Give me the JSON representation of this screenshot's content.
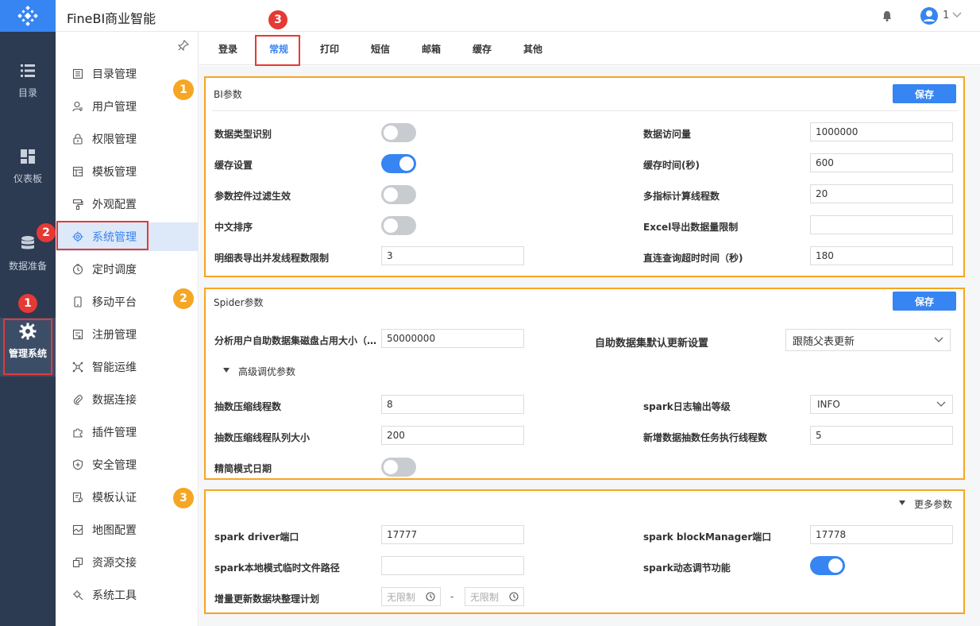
{
  "app_title": "FineBI商业智能",
  "user": {
    "name": "1"
  },
  "rail": [
    {
      "label": "目录",
      "icon": "list-icon"
    },
    {
      "label": "仪表板",
      "icon": "dashboard-icon"
    },
    {
      "label": "数据准备",
      "icon": "database-icon"
    },
    {
      "label": "管理系统",
      "icon": "gear-icon"
    }
  ],
  "menu": [
    {
      "label": "目录管理",
      "icon": "catalog-icon"
    },
    {
      "label": "用户管理",
      "icon": "user-icon"
    },
    {
      "label": "权限管理",
      "icon": "lock-icon"
    },
    {
      "label": "模板管理",
      "icon": "template-icon"
    },
    {
      "label": "外观配置",
      "icon": "brush-icon"
    },
    {
      "label": "系统管理",
      "icon": "settings-icon"
    },
    {
      "label": "定时调度",
      "icon": "clock-icon"
    },
    {
      "label": "移动平台",
      "icon": "mobile-icon"
    },
    {
      "label": "注册管理",
      "icon": "register-icon"
    },
    {
      "label": "智能运维",
      "icon": "nodes-icon"
    },
    {
      "label": "数据连接",
      "icon": "link-icon"
    },
    {
      "label": "插件管理",
      "icon": "plugin-icon"
    },
    {
      "label": "安全管理",
      "icon": "shield-icon"
    },
    {
      "label": "模板认证",
      "icon": "certificate-icon"
    },
    {
      "label": "地图配置",
      "icon": "map-icon"
    },
    {
      "label": "资源交接",
      "icon": "handover-icon"
    },
    {
      "label": "系统工具",
      "icon": "tool-icon"
    }
  ],
  "tabs": [
    "登录",
    "常规",
    "打印",
    "短信",
    "邮箱",
    "缓存",
    "其他"
  ],
  "bi": {
    "title": "BI参数",
    "save": "保存",
    "left": [
      {
        "label": "数据类型识别",
        "toggle": false
      },
      {
        "label": "缓存设置",
        "toggle": true
      },
      {
        "label": "参数控件过滤生效",
        "toggle": false
      },
      {
        "label": "中文排序",
        "toggle": false
      },
      {
        "label": "明细表导出并发线程数限制",
        "value": "3"
      }
    ],
    "right": [
      {
        "label": "数据访问量",
        "value": "1000000"
      },
      {
        "label": "缓存时间(秒)",
        "value": "600"
      },
      {
        "label": "多指标计算线程数",
        "value": "20"
      },
      {
        "label": "Excel导出数据量限制",
        "value": ""
      },
      {
        "label": "直连查询超时时间（秒)",
        "value": "180"
      }
    ]
  },
  "spider": {
    "title": "Spider参数",
    "save": "保存",
    "disk_label": "分析用户自助数据集磁盘占用大小（…",
    "disk_value": "50000000",
    "update_label": "自助数据集默认更新设置",
    "update_value": "跟随父表更新",
    "advanced": "高级调优参数",
    "threads_label": "抽数压缩线程数",
    "threads_value": "8",
    "log_label": "spark日志输出等级",
    "log_value": "INFO",
    "queue_label": "抽数压缩线程队列大小",
    "queue_value": "200",
    "task_label": "新增数据抽数任务执行线程数",
    "task_value": "5",
    "date_label": "精简模式日期",
    "date_toggle": false
  },
  "more": {
    "toggle_label": "更多参数",
    "driver_label": "spark driver端口",
    "driver_value": "17777",
    "block_label": "spark blockManager端口",
    "block_value": "17778",
    "path_label": "spark本地模式临时文件路径",
    "path_value": "",
    "dynamic_label": "spark动态调节功能",
    "dynamic_toggle": true,
    "plan_label": "增量更新数据块整理计划",
    "plan_from_placeholder": "无限制",
    "plan_sep": "-",
    "plan_to_placeholder": "无限制"
  },
  "annotations": {
    "badge1": "1",
    "badge2": "2",
    "badge3": "3",
    "red1": "1",
    "red2": "2",
    "red3": "3"
  },
  "colors": {
    "accent": "#3685f2",
    "rail": "#2c3a52",
    "frame": "#f5a623",
    "highlight": "#e53935"
  }
}
